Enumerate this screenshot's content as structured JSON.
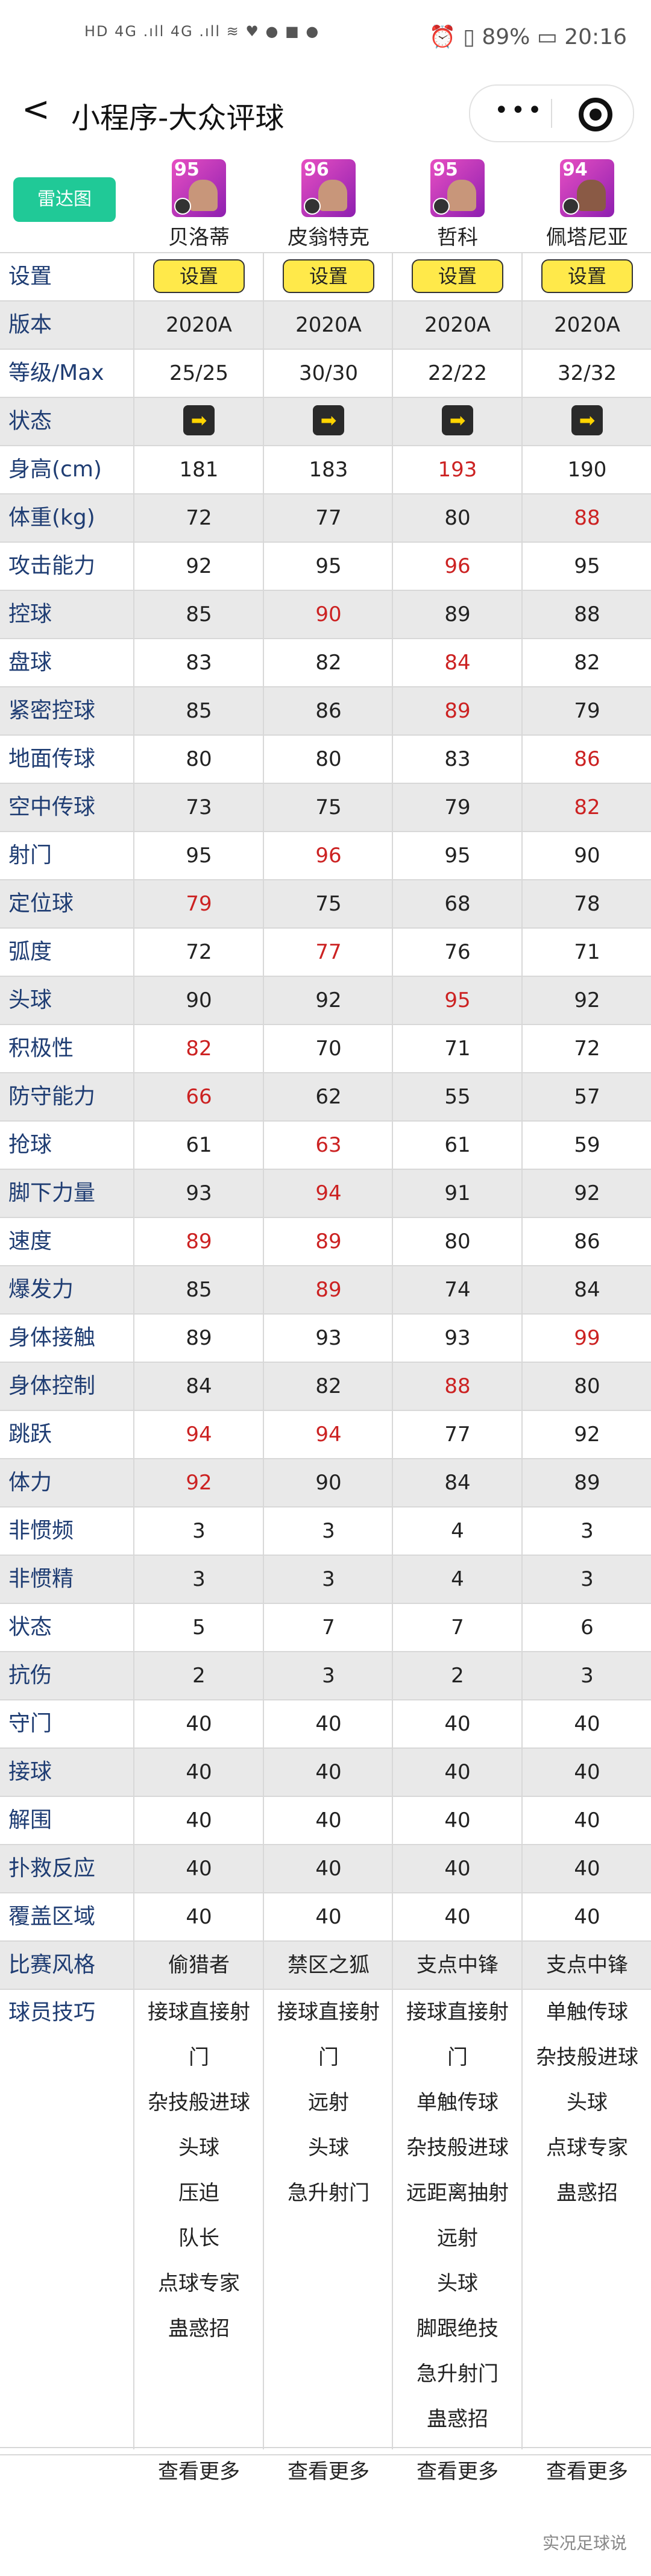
{
  "status_bar": {
    "left": "HD 4G .ıll 4G .ıll ≋ ♥ ● ■ ●",
    "right": "⏰ ▯ 89% ▭ 20:16"
  },
  "nav": {
    "back": "<",
    "title": "小程序-大众评球",
    "more": "•••"
  },
  "radar_label": "雷达图",
  "players": [
    {
      "name": "贝洛蒂",
      "rating": "95"
    },
    {
      "name": "皮翁特克",
      "rating": "96"
    },
    {
      "name": "哲科",
      "rating": "95"
    },
    {
      "name": "佩塔尼亚",
      "rating": "94"
    }
  ],
  "set_row": {
    "label": "设置",
    "button": "设置"
  },
  "status_row": {
    "label": "状态",
    "icon": "arrow-right-icon",
    "glyph": "➡"
  },
  "text_rows": [
    {
      "label": "版本",
      "values": [
        "2020A",
        "2020A",
        "2020A",
        "2020A"
      ]
    },
    {
      "label": "等级/Max",
      "values": [
        "25/25",
        "30/30",
        "22/22",
        "32/32"
      ]
    }
  ],
  "stat_rows": [
    {
      "label": "身高(cm)",
      "values": [
        "181",
        "183",
        "193",
        "190"
      ],
      "highlight": [
        false,
        false,
        true,
        false
      ]
    },
    {
      "label": "体重(kg)",
      "values": [
        "72",
        "77",
        "80",
        "88"
      ],
      "highlight": [
        false,
        false,
        false,
        true
      ]
    },
    {
      "label": "攻击能力",
      "values": [
        "92",
        "95",
        "96",
        "95"
      ],
      "highlight": [
        false,
        false,
        true,
        false
      ]
    },
    {
      "label": "控球",
      "values": [
        "85",
        "90",
        "89",
        "88"
      ],
      "highlight": [
        false,
        true,
        false,
        false
      ]
    },
    {
      "label": "盘球",
      "values": [
        "83",
        "82",
        "84",
        "82"
      ],
      "highlight": [
        false,
        false,
        true,
        false
      ]
    },
    {
      "label": "紧密控球",
      "values": [
        "85",
        "86",
        "89",
        "79"
      ],
      "highlight": [
        false,
        false,
        true,
        false
      ]
    },
    {
      "label": "地面传球",
      "values": [
        "80",
        "80",
        "83",
        "86"
      ],
      "highlight": [
        false,
        false,
        false,
        true
      ]
    },
    {
      "label": "空中传球",
      "values": [
        "73",
        "75",
        "79",
        "82"
      ],
      "highlight": [
        false,
        false,
        false,
        true
      ]
    },
    {
      "label": "射门",
      "values": [
        "95",
        "96",
        "95",
        "90"
      ],
      "highlight": [
        false,
        true,
        false,
        false
      ]
    },
    {
      "label": "定位球",
      "values": [
        "79",
        "75",
        "68",
        "78"
      ],
      "highlight": [
        true,
        false,
        false,
        false
      ]
    },
    {
      "label": "弧度",
      "values": [
        "72",
        "77",
        "76",
        "71"
      ],
      "highlight": [
        false,
        true,
        false,
        false
      ]
    },
    {
      "label": "头球",
      "values": [
        "90",
        "92",
        "95",
        "92"
      ],
      "highlight": [
        false,
        false,
        true,
        false
      ]
    },
    {
      "label": "积极性",
      "values": [
        "82",
        "70",
        "71",
        "72"
      ],
      "highlight": [
        true,
        false,
        false,
        false
      ]
    },
    {
      "label": "防守能力",
      "values": [
        "66",
        "62",
        "55",
        "57"
      ],
      "highlight": [
        true,
        false,
        false,
        false
      ]
    },
    {
      "label": "抢球",
      "values": [
        "61",
        "63",
        "61",
        "59"
      ],
      "highlight": [
        false,
        true,
        false,
        false
      ]
    },
    {
      "label": "脚下力量",
      "values": [
        "93",
        "94",
        "91",
        "92"
      ],
      "highlight": [
        false,
        true,
        false,
        false
      ]
    },
    {
      "label": "速度",
      "values": [
        "89",
        "89",
        "80",
        "86"
      ],
      "highlight": [
        true,
        true,
        false,
        false
      ]
    },
    {
      "label": "爆发力",
      "values": [
        "85",
        "89",
        "74",
        "84"
      ],
      "highlight": [
        false,
        true,
        false,
        false
      ]
    },
    {
      "label": "身体接触",
      "values": [
        "89",
        "93",
        "93",
        "99"
      ],
      "highlight": [
        false,
        false,
        false,
        true
      ]
    },
    {
      "label": "身体控制",
      "values": [
        "84",
        "82",
        "88",
        "80"
      ],
      "highlight": [
        false,
        false,
        true,
        false
      ]
    },
    {
      "label": "跳跃",
      "values": [
        "94",
        "94",
        "77",
        "92"
      ],
      "highlight": [
        true,
        true,
        false,
        false
      ]
    },
    {
      "label": "体力",
      "values": [
        "92",
        "90",
        "84",
        "89"
      ],
      "highlight": [
        true,
        false,
        false,
        false
      ]
    },
    {
      "label": "非惯频",
      "values": [
        "3",
        "3",
        "4",
        "3"
      ],
      "highlight": [
        false,
        false,
        false,
        false
      ]
    },
    {
      "label": "非惯精",
      "values": [
        "3",
        "3",
        "4",
        "3"
      ],
      "highlight": [
        false,
        false,
        false,
        false
      ]
    },
    {
      "label": "状态",
      "values": [
        "5",
        "7",
        "7",
        "6"
      ],
      "highlight": [
        false,
        false,
        false,
        false
      ]
    },
    {
      "label": "抗伤",
      "values": [
        "2",
        "3",
        "2",
        "3"
      ],
      "highlight": [
        false,
        false,
        false,
        false
      ]
    },
    {
      "label": "守门",
      "values": [
        "40",
        "40",
        "40",
        "40"
      ],
      "highlight": [
        false,
        false,
        false,
        false
      ]
    },
    {
      "label": "接球",
      "values": [
        "40",
        "40",
        "40",
        "40"
      ],
      "highlight": [
        false,
        false,
        false,
        false
      ]
    },
    {
      "label": "解围",
      "values": [
        "40",
        "40",
        "40",
        "40"
      ],
      "highlight": [
        false,
        false,
        false,
        false
      ]
    },
    {
      "label": "扑救反应",
      "values": [
        "40",
        "40",
        "40",
        "40"
      ],
      "highlight": [
        false,
        false,
        false,
        false
      ]
    },
    {
      "label": "覆盖区域",
      "values": [
        "40",
        "40",
        "40",
        "40"
      ],
      "highlight": [
        false,
        false,
        false,
        false
      ]
    }
  ],
  "style_row": {
    "label": "比赛风格",
    "values": [
      "偷猎者",
      "禁区之狐",
      "支点中锋",
      "支点中锋"
    ]
  },
  "skills_row": {
    "label": "球员技巧",
    "values": [
      [
        "接球直接射",
        "门",
        "杂技般进球",
        "头球",
        "压迫",
        "队长",
        "点球专家",
        "蛊惑招"
      ],
      [
        "接球直接射",
        "门",
        "远射",
        "头球",
        "急升射门"
      ],
      [
        "接球直接射",
        "门",
        "单触传球",
        "杂技般进球",
        "远距离抽射",
        "远射",
        "头球",
        "脚跟绝技",
        "急升射门",
        "蛊惑招"
      ],
      [
        "单触传球",
        "杂技般进球",
        "头球",
        "点球专家",
        "蛊惑招"
      ]
    ]
  },
  "more_label": "查看更多",
  "watermark": "实况足球说",
  "colors": {
    "accent": "#20c997",
    "label": "#1f3d73",
    "highlight": "#cc2222",
    "button": "#ffe94a"
  }
}
